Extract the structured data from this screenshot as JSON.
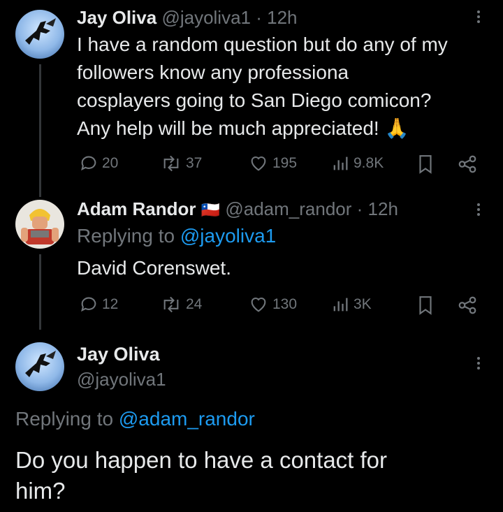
{
  "tweet1": {
    "display_name": "Jay Oliva",
    "handle": "@jayoliva1",
    "separator": "·",
    "time": "12h",
    "text_lines": [
      "I have a random question but do any of my",
      "followers know any professiona",
      "cosplayers going to San Diego comicon?",
      "Any help will be much appreciated! 🙏"
    ],
    "stats": {
      "replies": "20",
      "reposts": "37",
      "likes": "195",
      "views": "9.8K"
    }
  },
  "tweet2": {
    "display_name": "Adam Randor",
    "flag": "🇨🇱",
    "handle": "@adam_randor",
    "separator": "·",
    "time": "12h",
    "replying_label": "Replying to",
    "replying_handle": "@jayoliva1",
    "text": "David Corenswet.",
    "stats": {
      "replies": "12",
      "reposts": "24",
      "likes": "130",
      "views": "3K"
    }
  },
  "tweet3": {
    "display_name": "Jay Oliva",
    "handle": "@jayoliva1",
    "replying_label": "Replying to",
    "replying_handle": "@adam_randor",
    "text_lines": [
      "Do you happen to have a contact for",
      "him?"
    ]
  },
  "colors": {
    "background": "#000000",
    "text": "#e7e9ea",
    "muted": "#71767b",
    "link": "#1d9bf0"
  }
}
